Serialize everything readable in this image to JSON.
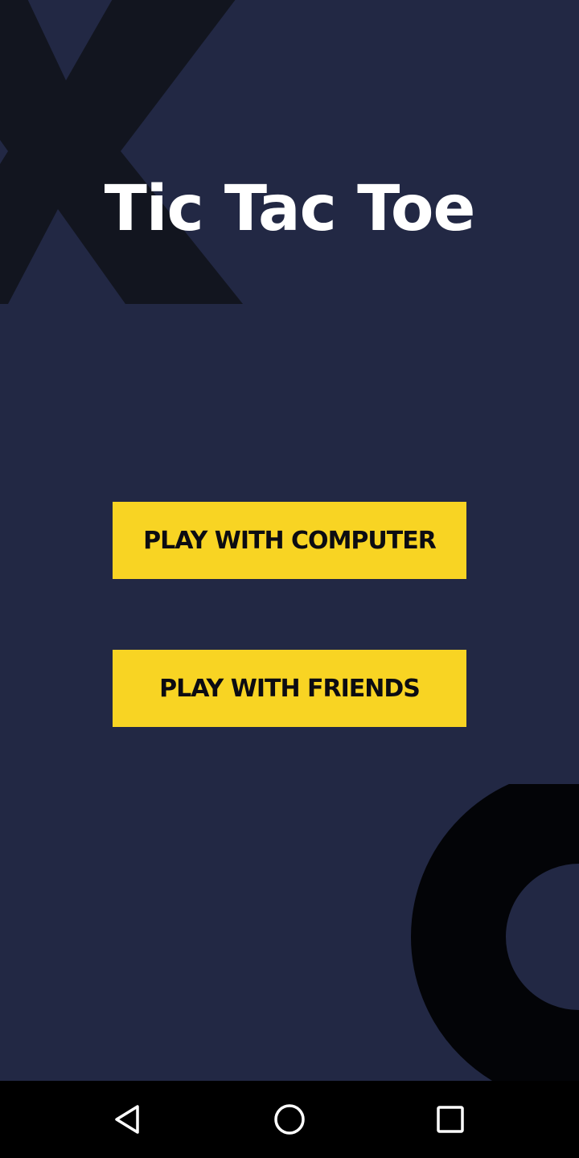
{
  "app": {
    "title": "Tic Tac Toe",
    "colors": {
      "background": "#222844",
      "decor_x": "#12151f",
      "decor_o": "#030407",
      "button_bg": "#f8d423",
      "button_text": "#0c0c12",
      "title_text": "#ffffff",
      "navbar_bg": "#000000"
    }
  },
  "menu": {
    "play_computer_label": "PLAY WITH COMPUTER",
    "play_friends_label": "PLAY WITH FRIENDS"
  },
  "decor": {
    "x_icon": "x-mark-icon",
    "o_icon": "o-mark-icon"
  },
  "navbar": {
    "back_icon": "back-triangle-icon",
    "home_icon": "home-circle-icon",
    "recents_icon": "recents-square-icon"
  }
}
